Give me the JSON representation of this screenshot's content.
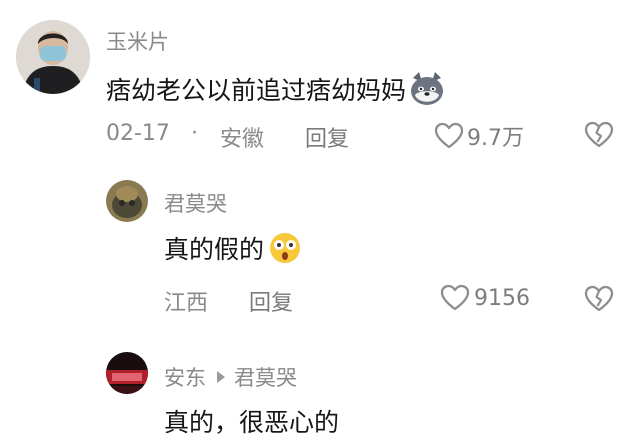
{
  "comments": [
    {
      "username": "玉米片",
      "text": "痞幼老公以前追过痞幼妈妈",
      "emoji_icon": "husky-dog-emoji-icon",
      "date": "02-17",
      "separator": "·",
      "location": "安徽",
      "reply_label": "回复",
      "like_count": "9.7万"
    },
    {
      "username": "君莫哭",
      "text": "真的假的",
      "emoji_icon": "shocked-face-emoji-icon",
      "location": "江西",
      "reply_label": "回复",
      "like_count": "9156"
    },
    {
      "username": "安东",
      "reply_to": "君莫哭",
      "text": "真的，很恶心的"
    }
  ],
  "colors": {
    "meta_text": "#8a8a8a",
    "body_text": "#161616",
    "icon_gray": "#8d8d8d"
  }
}
